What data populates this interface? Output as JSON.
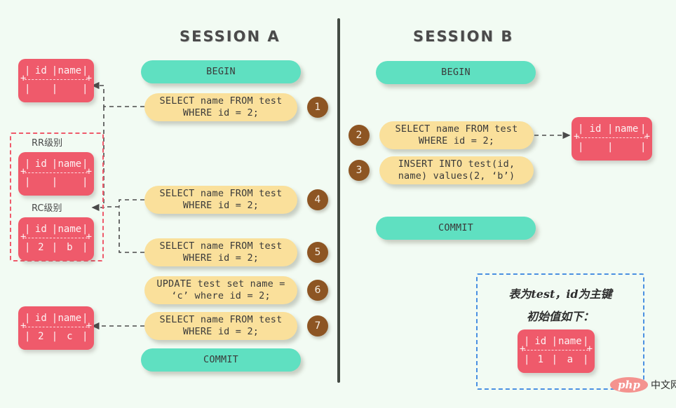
{
  "background": "#f2fbf3",
  "colors": {
    "teal": "#5fe0c1",
    "yellow": "#fae09b",
    "red": "#ef5a6b",
    "brown": "#8d5523",
    "divider": "#434b43",
    "blue_dash": "#4a90e2"
  },
  "sessions": {
    "a": {
      "title": "SESSION A",
      "steps": [
        {
          "label": "BEGIN",
          "kind": "begin",
          "badge": null
        },
        {
          "label": "SELECT name FROM test\nWHERE id = 2;",
          "kind": "sql",
          "badge": "1"
        },
        {
          "label": "SELECT name FROM test\nWHERE id = 2;",
          "kind": "sql",
          "badge": "4"
        },
        {
          "label": "SELECT name FROM test\nWHERE id = 2;",
          "kind": "sql",
          "badge": "5"
        },
        {
          "label": "UPDATE test set name =\n‘c’ where id = 2;",
          "kind": "sql",
          "badge": "6"
        },
        {
          "label": "SELECT name FROM test\nWHERE id = 2;",
          "kind": "sql",
          "badge": "7"
        },
        {
          "label": "COMMIT",
          "kind": "commit",
          "badge": null
        }
      ]
    },
    "b": {
      "title": "SESSION B",
      "steps": [
        {
          "label": "BEGIN",
          "kind": "begin",
          "badge": null
        },
        {
          "label": "SELECT name FROM test\nWHERE id = 2;",
          "kind": "sql",
          "badge": "2"
        },
        {
          "label": "INSERT INTO test(id,\nname) values(2, ‘b’)",
          "kind": "sql",
          "badge": "3"
        },
        {
          "label": "COMMIT",
          "kind": "commit",
          "badge": null
        }
      ]
    }
  },
  "tables": {
    "a_empty_top": {
      "header": {
        "c1": "id",
        "c2": "name"
      },
      "rows": [
        {
          "c1": "",
          "c2": ""
        }
      ]
    },
    "rr_level": {
      "label": "RR级别",
      "header": {
        "c1": "id",
        "c2": "name"
      },
      "rows": [
        {
          "c1": "",
          "c2": ""
        }
      ]
    },
    "rc_level": {
      "label": "RC级别",
      "header": {
        "c1": "id",
        "c2": "name"
      },
      "rows": [
        {
          "c1": "2",
          "c2": "b"
        }
      ]
    },
    "a_after_update": {
      "header": {
        "c1": "id",
        "c2": "name"
      },
      "rows": [
        {
          "c1": "2",
          "c2": "c"
        }
      ]
    },
    "b_empty": {
      "header": {
        "c1": "id",
        "c2": "name"
      },
      "rows": [
        {
          "c1": "",
          "c2": ""
        }
      ]
    },
    "initial": {
      "header": {
        "c1": "id",
        "c2": "name"
      },
      "rows": [
        {
          "c1": "1",
          "c2": "a"
        }
      ]
    }
  },
  "note": {
    "line1": "表为test，id为主键",
    "line2": "初始值如下："
  },
  "watermark": {
    "logo": "php",
    "text": "中文网"
  }
}
